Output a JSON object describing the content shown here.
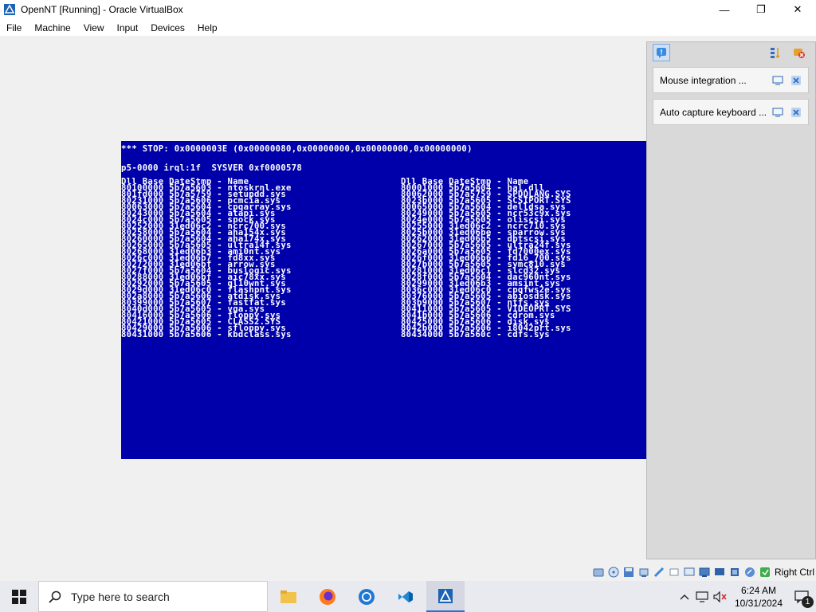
{
  "window": {
    "title": "OpenNT [Running] - Oracle VirtualBox",
    "minimize": "—",
    "maximize": "❐",
    "close": "✕"
  },
  "menu": [
    "File",
    "Machine",
    "View",
    "Input",
    "Devices",
    "Help"
  ],
  "bsod": {
    "stop_line": "*** STOP: 0x0000003E (0x00000080,0x00000000,0x00000000,0x00000000)",
    "info_line": "p5-0000 irql:1f  SYSVER 0xf0000578",
    "left_header": "Dll Base DateStmp - Name",
    "right_header": "Dll Base DateStmp - Name",
    "left_rows": [
      "80100000 5b7a5603 - ntoskrnl.exe",
      "801fd000 5b7a5759 - setupdd.sys",
      "80231000 5b7a5606 - pcmcia.sys",
      "80063000 5b7a5604 - cpqarray.sys",
      "80243000 5b7a5604 - atapi.sys",
      "8024c000 5b7a5605 - spock.sys",
      "80252000 31ed06c2 - ncrc700.sys",
      "80258000 5b7a5604 - aha154x.sys",
      "80260000 5b7a5604 - aha174x.sys",
      "80265000 5b7a5605 - ultra14f.sys",
      "80268000 31ed06b3 - ami0nt.sys",
      "8026c000 31ed06b7 - fd8xx.sys",
      "80272000 31ed06bf - arrow.sys",
      "8027f000 5b7a5604 - buslogic.sys",
      "80288000 31ed06bf - aic78xx.sys",
      "80292000 5b7a5605 - ql10wnt.sys",
      "8029d000 31ed06c0 - flashpnt.sys",
      "802a8000 5b7a5606 - atdisk.sys",
      "80399000 5b7a5607 - fastfat.sys",
      "8040d000 5b7a5605 - vga.sys",
      "80416000 5b7a5606 - floppy.sys",
      "80421000 5b7a5605 - CLASS2.SYS",
      "80429000 5b7a5606 - sfloppy.sys",
      "80431000 5b7a5606 - kbdclass.sys"
    ],
    "right_rows": [
      "80001000 5b7a5604 - hal.dll",
      "80062000 5b7a5759 - SPDDLANG.SYS",
      "8023b000 5b7a5605 - SCSIPORT.SYS",
      "80065000 5b7a5604 - delldsa.sys",
      "80249000 5b7a5605 - ncr53c9x.sys",
      "8024e000 5b7a5605 - oliscsi.sys",
      "80255000 31ed06c2 - ncrc710.sys",
      "8025b000 31ed06be - sparrow.sys",
      "80262000 31ed06b5 - dptscsi.sys",
      "80267000 5b7a5605 - ultra24f.sys",
      "8026a000 5b7a5605 - fd7000ex.sys",
      "8026f000 31ed06b6 - fd16_700.sys",
      "8027b000 5b7a5605 - symc810.sys",
      "80281000 31ed06c1 - slcd32.sys",
      "8028f000 5b7a5604 - dac960nt.sys",
      "80299000 31ed06b3 - amsint.sys",
      "8036c000 31ed06c0 - cpqfws2e.sys",
      "80376000 5b7a5605 - abiosdsk.sys",
      "803b9000 5b7a5607 - ntfs.sys",
      "80411000 5b7a5605 - VIDEOPRT.SYS",
      "8041b000 5b7a5606 - cdrom.sys",
      "80425000 5b7a5606 - disk.sys",
      "8042b000 5b7a5606 - i8042prt.sys",
      "80434000 5b7a560c - cdfs.sys"
    ]
  },
  "side_panel": {
    "notices": [
      {
        "label": "Mouse integration ..."
      },
      {
        "label": "Auto capture keyboard ..."
      }
    ]
  },
  "statusbar": {
    "host_key": "Right Ctrl"
  },
  "taskbar": {
    "search_placeholder": "Type here to search",
    "time": "6:24 AM",
    "date": "10/31/2024",
    "notification_count": "1"
  },
  "colors": {
    "bsod_blue": "#0000aa",
    "bsod_text": "#ffffff",
    "accent": "#2f6fd1"
  }
}
